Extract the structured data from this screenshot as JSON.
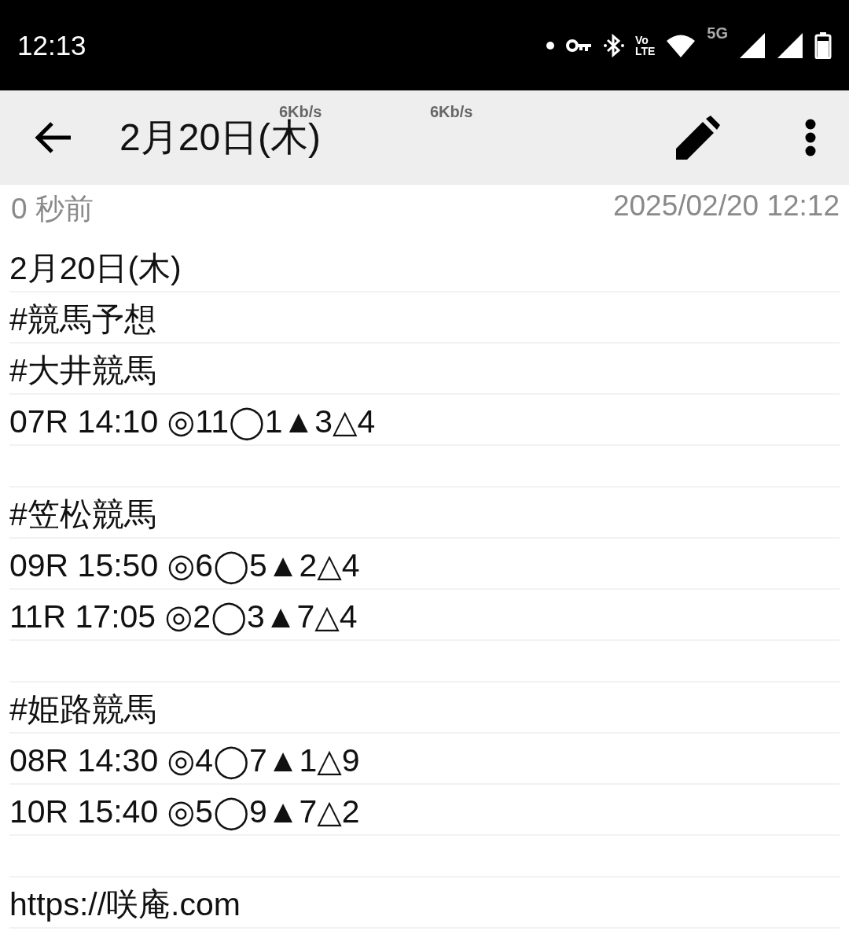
{
  "status_bar": {
    "time": "12:13",
    "volte_top": "Vo",
    "volte_bottom": "LTE",
    "network": "5G"
  },
  "toolbar": {
    "title": "2月20日(木)",
    "speed_labels": [
      "6Kb/s",
      "6Kb/s"
    ]
  },
  "meta": {
    "relative_time": "0 秒前",
    "timestamp": "2025/02/20 12:12"
  },
  "note": {
    "lines": [
      {
        "kind": "text",
        "text": "2月20日(木)"
      },
      {
        "kind": "text",
        "text": "#競馬予想"
      },
      {
        "kind": "text",
        "text": "#大井競馬"
      },
      {
        "kind": "text",
        "text": "07R 14:10 ◎11◯1▲3△4"
      },
      {
        "kind": "blank"
      },
      {
        "kind": "text",
        "text": "#笠松競馬"
      },
      {
        "kind": "text",
        "text": "09R 15:50 ◎6◯5▲2△4"
      },
      {
        "kind": "text",
        "text": "11R 17:05 ◎2◯3▲7△4"
      },
      {
        "kind": "blank"
      },
      {
        "kind": "text",
        "text": "#姫路競馬"
      },
      {
        "kind": "text",
        "text": "08R 14:30 ◎4◯7▲1△9"
      },
      {
        "kind": "text",
        "text": "10R 15:40 ◎5◯9▲7△2"
      },
      {
        "kind": "blank"
      },
      {
        "kind": "text",
        "text": "https://咲庵.com"
      }
    ]
  }
}
